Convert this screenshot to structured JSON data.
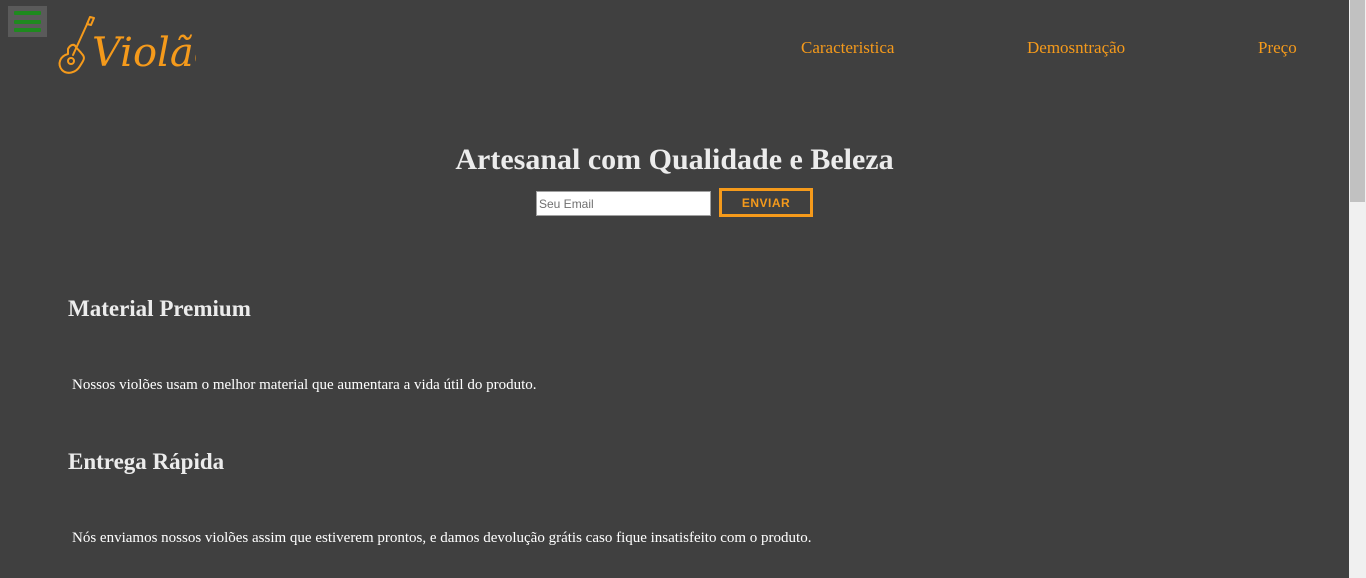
{
  "header": {
    "menu_toggle_icon": "hamburger-icon",
    "logo": {
      "text": "Violão",
      "icon": "guitar-icon",
      "color": "#f59a1b"
    },
    "nav": [
      {
        "label": "Caracteristica"
      },
      {
        "label": "Demosntração"
      },
      {
        "label": "Preço"
      }
    ]
  },
  "hero": {
    "title": "Artesanal com Qualidade e Beleza",
    "email_placeholder": "Seu Email",
    "email_value": "",
    "submit_label": "ENVIAR"
  },
  "features": [
    {
      "title": "Material Premium",
      "text": "Nossos violões usam o melhor material que aumentara a vida útil do produto."
    },
    {
      "title": "Entrega Rápida",
      "text": "Nós enviamos nossos violões assim que estiverem prontos, e damos devolução grátis caso fique insatisfeito com o produto."
    }
  ],
  "colors": {
    "background": "#404040",
    "accent": "#f59a1b",
    "menu_icon": "#1f8a1f",
    "heading": "#ececec"
  }
}
